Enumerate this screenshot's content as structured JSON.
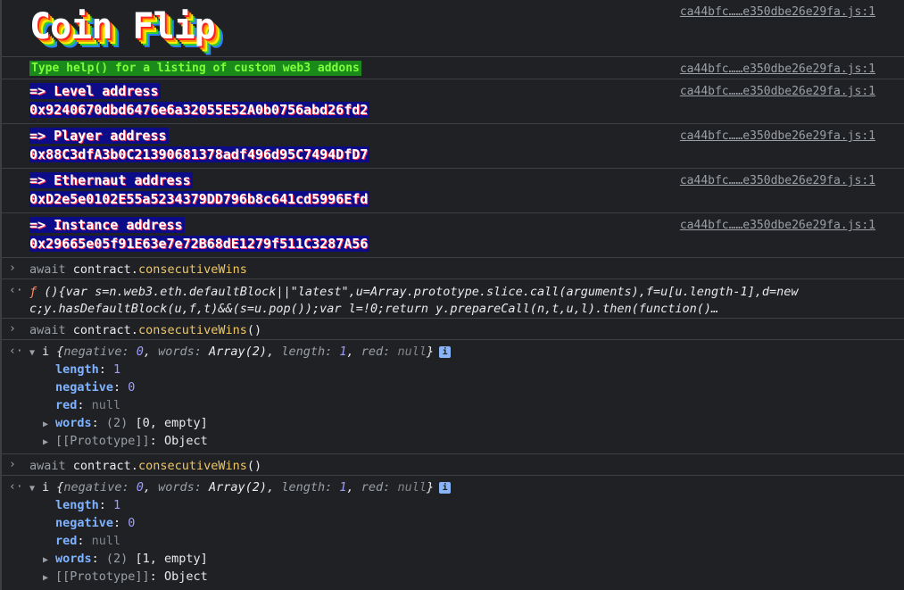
{
  "source_link": "ca44bfc……e350dbe26e29fa.js:1",
  "banner": {
    "title": "Coin Flip"
  },
  "help": {
    "text": "Type help() for a listing of custom web3 addons"
  },
  "addresses": [
    {
      "label": "=> Level address",
      "value": "0x9240670dbd6476e6a32055E52A0b0756abd26fd2"
    },
    {
      "label": "=> Player address",
      "value": "0x88C3dfA3b0C21390681378adf496d95C7494DfD7"
    },
    {
      "label": "=> Ethernaut address",
      "value": "0xD2e5e0102E55a5234379DD796b8c641cd5996Efd"
    },
    {
      "label": "=> Instance address",
      "value": "0x29665e05f91E63e7e72B68dE1279f511C3287A56"
    }
  ],
  "commands": [
    {
      "keyword": "await",
      "object": "contract.",
      "property": "consecutiveWins",
      "call": ""
    },
    {
      "keyword": "await",
      "object": "contract.",
      "property": "consecutiveWins",
      "call": "()"
    },
    {
      "keyword": "await",
      "object": "contract.",
      "property": "consecutiveWins",
      "call": "()"
    }
  ],
  "fn_result": {
    "symbol": "ƒ",
    "line1": " (){var s=n.web3.eth.defaultBlock||\"latest\",u=Array.prototype.slice.call(arguments),f=u[u.length-1],d=new",
    "line2": "c;y.hasDefaultBlock(u,f,t)&&(s=u.pop());var l=!0;return y.prepareCall(n,t,u,l).then(function()…"
  },
  "objects": [
    {
      "name": "i",
      "summary": {
        "open": "{",
        "negative_key": "negative",
        "negative_val": "0",
        "words_key": "words",
        "words_val": "Array(2)",
        "length_key": "length",
        "length_val": "1",
        "red_key": "red",
        "red_val": "null",
        "close": "}"
      },
      "length": {
        "key": "length",
        "value": "1"
      },
      "negative": {
        "key": "negative",
        "value": "0"
      },
      "red": {
        "key": "red",
        "value": "null"
      },
      "words": {
        "key": "words",
        "count": "(2)",
        "value": "[0, empty]"
      },
      "prototype": {
        "key": "[[Prototype]]",
        "value": "Object"
      }
    },
    {
      "name": "i",
      "summary": {
        "open": "{",
        "negative_key": "negative",
        "negative_val": "0",
        "words_key": "words",
        "words_val": "Array(2)",
        "length_key": "length",
        "length_val": "1",
        "red_key": "red",
        "red_val": "null",
        "close": "}"
      },
      "length": {
        "key": "length",
        "value": "1"
      },
      "negative": {
        "key": "negative",
        "value": "0"
      },
      "red": {
        "key": "red",
        "value": "null"
      },
      "words": {
        "key": "words",
        "count": "(2)",
        "value": "[1, empty]"
      },
      "prototype": {
        "key": "[[Prototype]]",
        "value": "Object"
      }
    }
  ],
  "icons": {
    "prompt": "chevron-right-icon",
    "return": "return-arrow-icon",
    "expand": "triangle-down-icon",
    "collapsed": "triangle-right-icon",
    "info": "info-icon"
  },
  "colors": {
    "background": "#202124",
    "property_yellow": "#f0c862",
    "number_purple": "#9e9eff",
    "key_blue": "#7fb3ff",
    "help_bg": "#1a8a1a",
    "help_fg": "#7cff3a",
    "addr_bg": "#0c0c88"
  }
}
